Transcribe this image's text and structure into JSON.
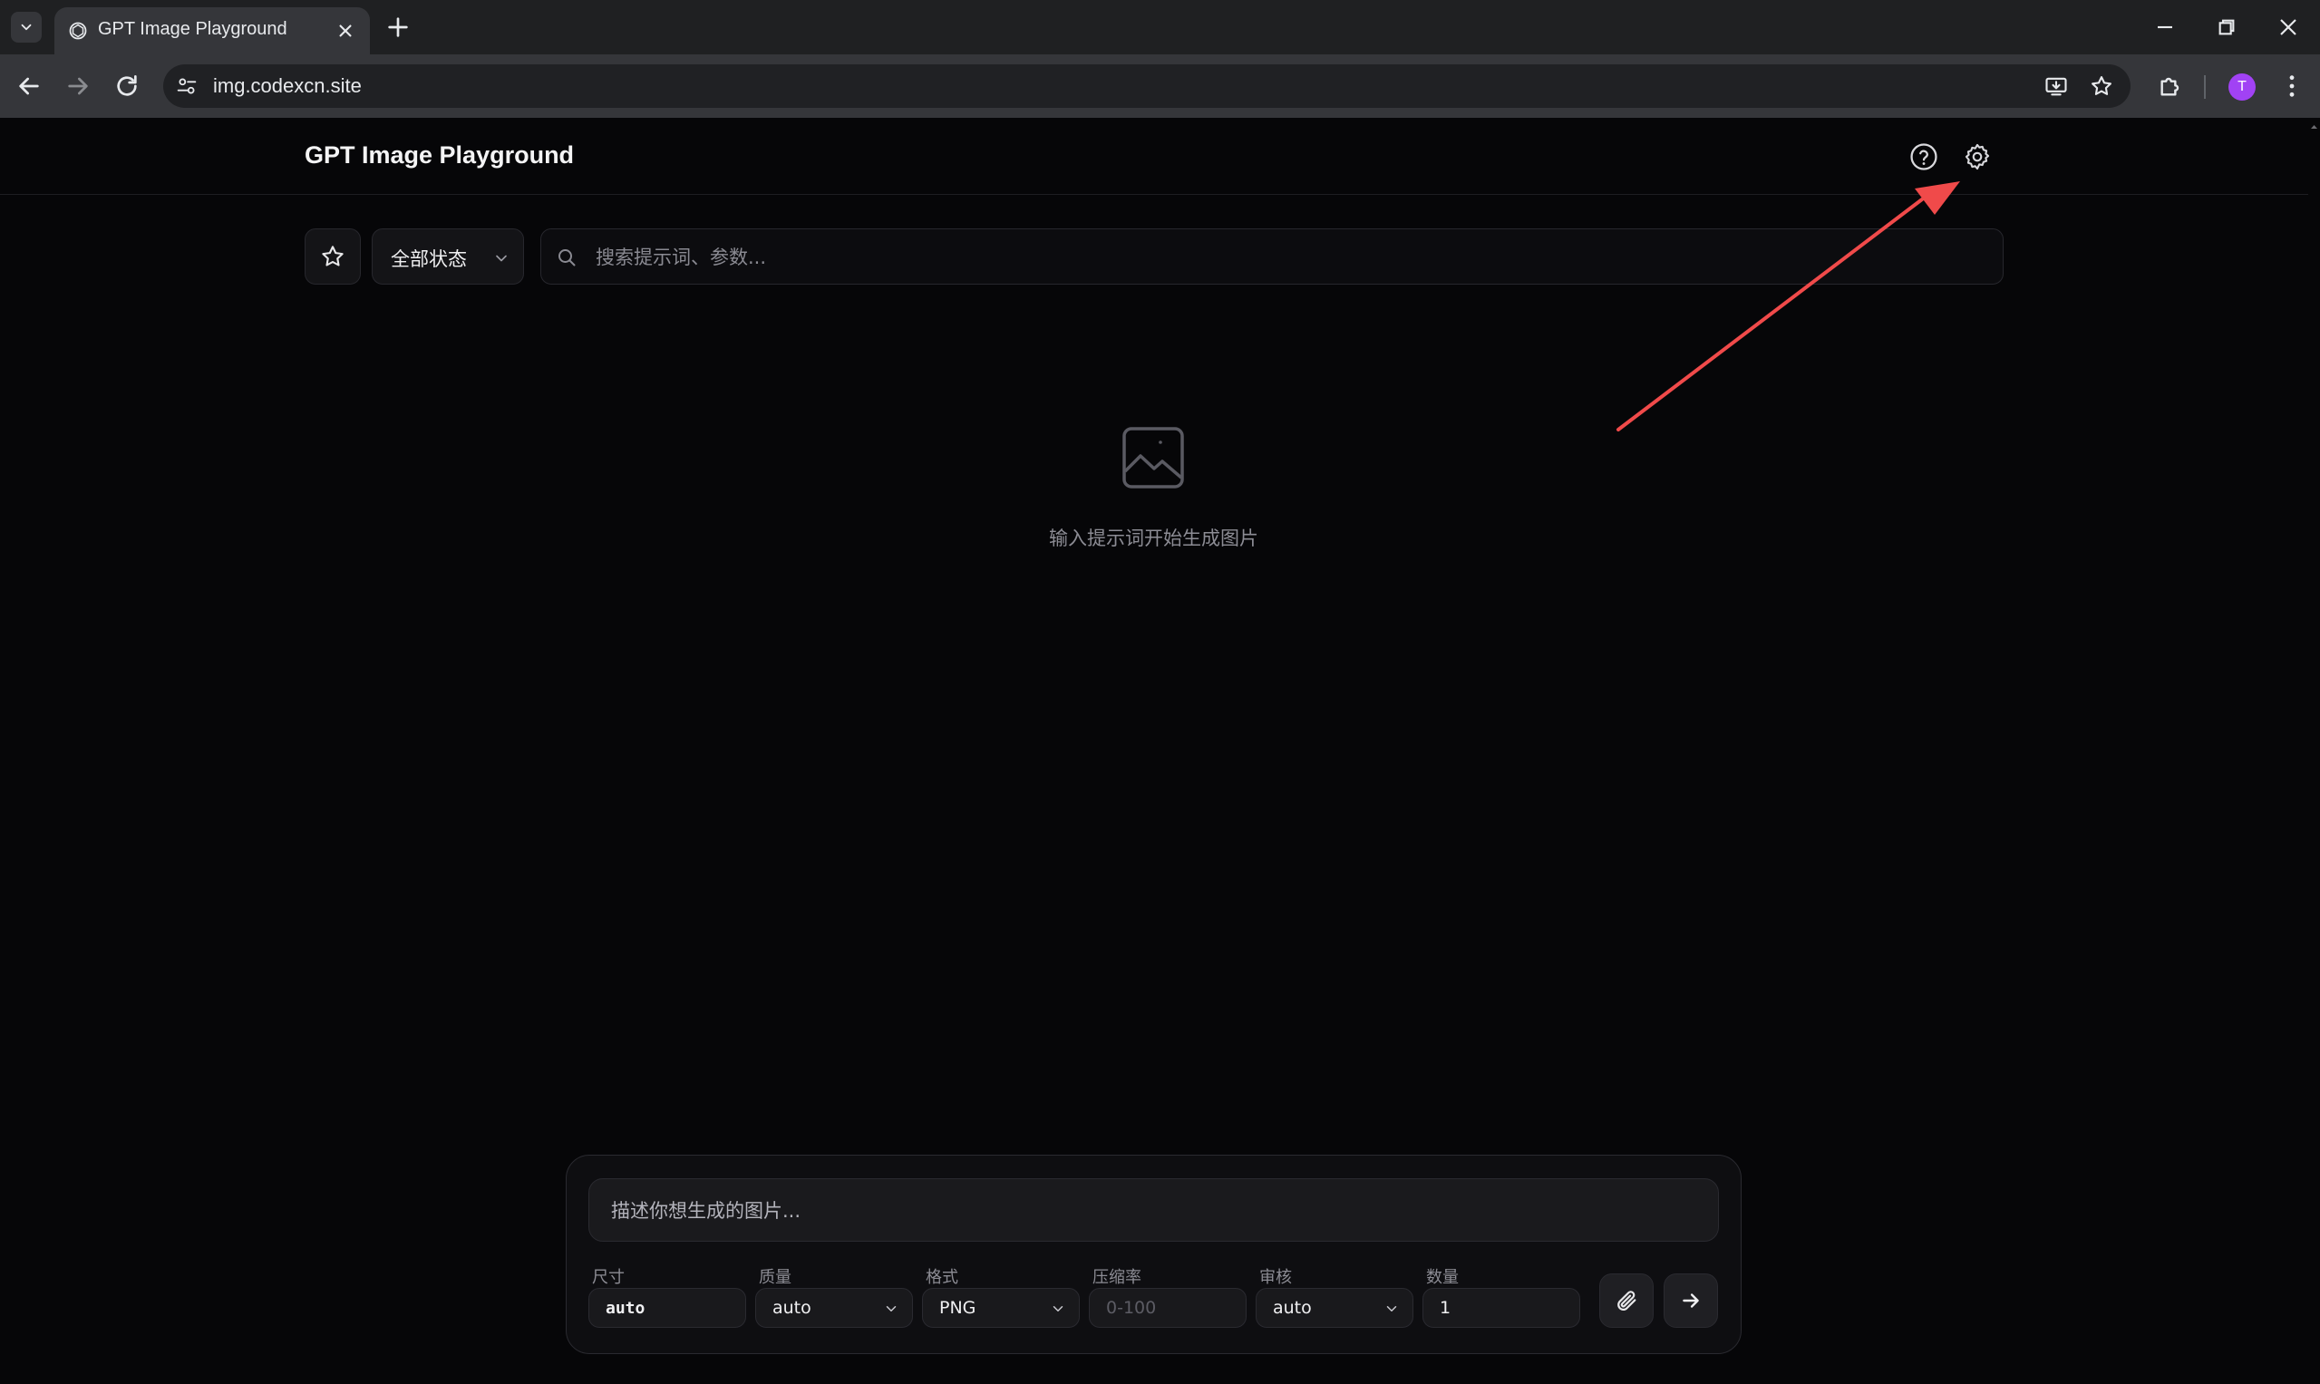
{
  "browser": {
    "tab_title": "GPT Image Playground",
    "url": "img.codexcn.site",
    "profile_initial": "T"
  },
  "header": {
    "title": "GPT Image Playground"
  },
  "filters": {
    "status_label": "全部状态",
    "search_placeholder": "搜索提示词、参数..."
  },
  "empty_state": {
    "text": "输入提示词开始生成图片"
  },
  "composer": {
    "prompt_placeholder": "描述你想生成的图片...",
    "params": {
      "size": {
        "label": "尺寸",
        "value": "auto"
      },
      "quality": {
        "label": "质量",
        "value": "auto"
      },
      "format": {
        "label": "格式",
        "value": "PNG"
      },
      "compression": {
        "label": "压缩率",
        "placeholder": "0-100"
      },
      "moderation": {
        "label": "审核",
        "value": "auto"
      },
      "count": {
        "label": "数量",
        "value": "1"
      }
    }
  },
  "colors": {
    "background": "#060608",
    "annotation_arrow": "#f04a4a"
  }
}
